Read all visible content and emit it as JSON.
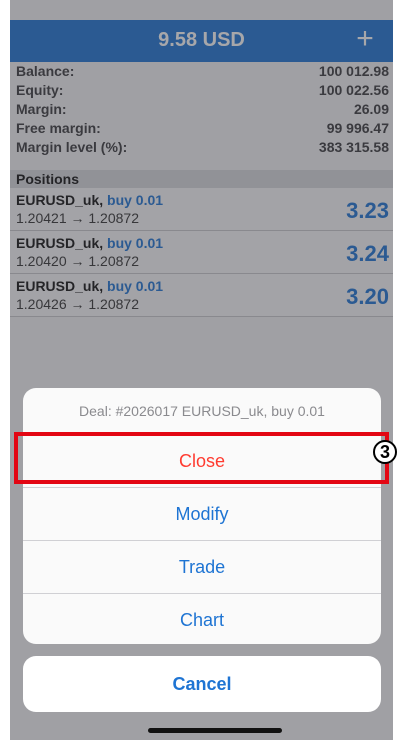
{
  "header": {
    "title": "9.58 USD",
    "add_label": "+"
  },
  "account": [
    {
      "label": "Balance:",
      "value": "100 012.98"
    },
    {
      "label": "Equity:",
      "value": "100 022.56"
    },
    {
      "label": "Margin:",
      "value": "26.09"
    },
    {
      "label": "Free margin:",
      "value": "99 996.47"
    },
    {
      "label": "Margin level (%):",
      "value": "383 315.58"
    }
  ],
  "positions_header": "Positions",
  "positions": [
    {
      "symbol": "EURUSD_uk,",
      "side": "buy 0.01",
      "prices": "1.20421 → 1.20872",
      "profit": "3.23"
    },
    {
      "symbol": "EURUSD_uk,",
      "side": "buy 0.01",
      "prices": "1.20420 → 1.20872",
      "profit": "3.24"
    },
    {
      "symbol": "EURUSD_uk,",
      "side": "buy 0.01",
      "prices": "1.20426 → 1.20872",
      "profit": "3.20"
    }
  ],
  "action_sheet": {
    "title": "Deal: #2026017 EURUSD_uk, buy 0.01",
    "buttons": [
      "Close",
      "Modify",
      "Trade",
      "Chart"
    ],
    "cancel": "Cancel"
  },
  "annotation": {
    "badge": "3"
  },
  "colors": {
    "accent": "#1e74d3",
    "destructive": "#ff3b30",
    "highlight": "#e30613"
  }
}
